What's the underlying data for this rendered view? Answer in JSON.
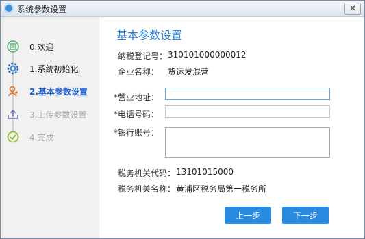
{
  "window": {
    "title": "系统参数设置",
    "close_label": "✕"
  },
  "sidebar": {
    "steps": [
      {
        "label": "0.欢迎",
        "icon": "welcome-icon",
        "state": "done"
      },
      {
        "label": "1.系统初始化",
        "icon": "gear-icon",
        "state": "done"
      },
      {
        "label": "2.基本参数设置",
        "icon": "user-icon",
        "state": "active"
      },
      {
        "label": "3.上传参数设置",
        "icon": "upload-icon",
        "state": "disabled"
      },
      {
        "label": "4.完成",
        "icon": "check-icon",
        "state": "disabled"
      }
    ]
  },
  "main": {
    "title": "基本参数设置",
    "taxpayer_id": {
      "label": "纳税登记号：",
      "value": "310101000000012"
    },
    "company_name": {
      "label": "企业名称：",
      "value": "货运发混营"
    },
    "business_address": {
      "label": "*营业地址：",
      "value": ""
    },
    "phone": {
      "label": "*电话号码：",
      "value": ""
    },
    "bank_account": {
      "label": "*银行账号：",
      "value": ""
    },
    "tax_office_code": {
      "label": "税务机关代码：",
      "value": "13101015000"
    },
    "tax_office_name": {
      "label": "税务机关名称：",
      "value": "黄浦区税务局第一税务所"
    }
  },
  "buttons": {
    "prev": "上一步",
    "next": "下一步"
  },
  "colors": {
    "accent": "#2a8ae0",
    "heading": "#2c7fd0",
    "active_step": "#1f5fcc",
    "disabled_step": "#a8a8a8"
  }
}
